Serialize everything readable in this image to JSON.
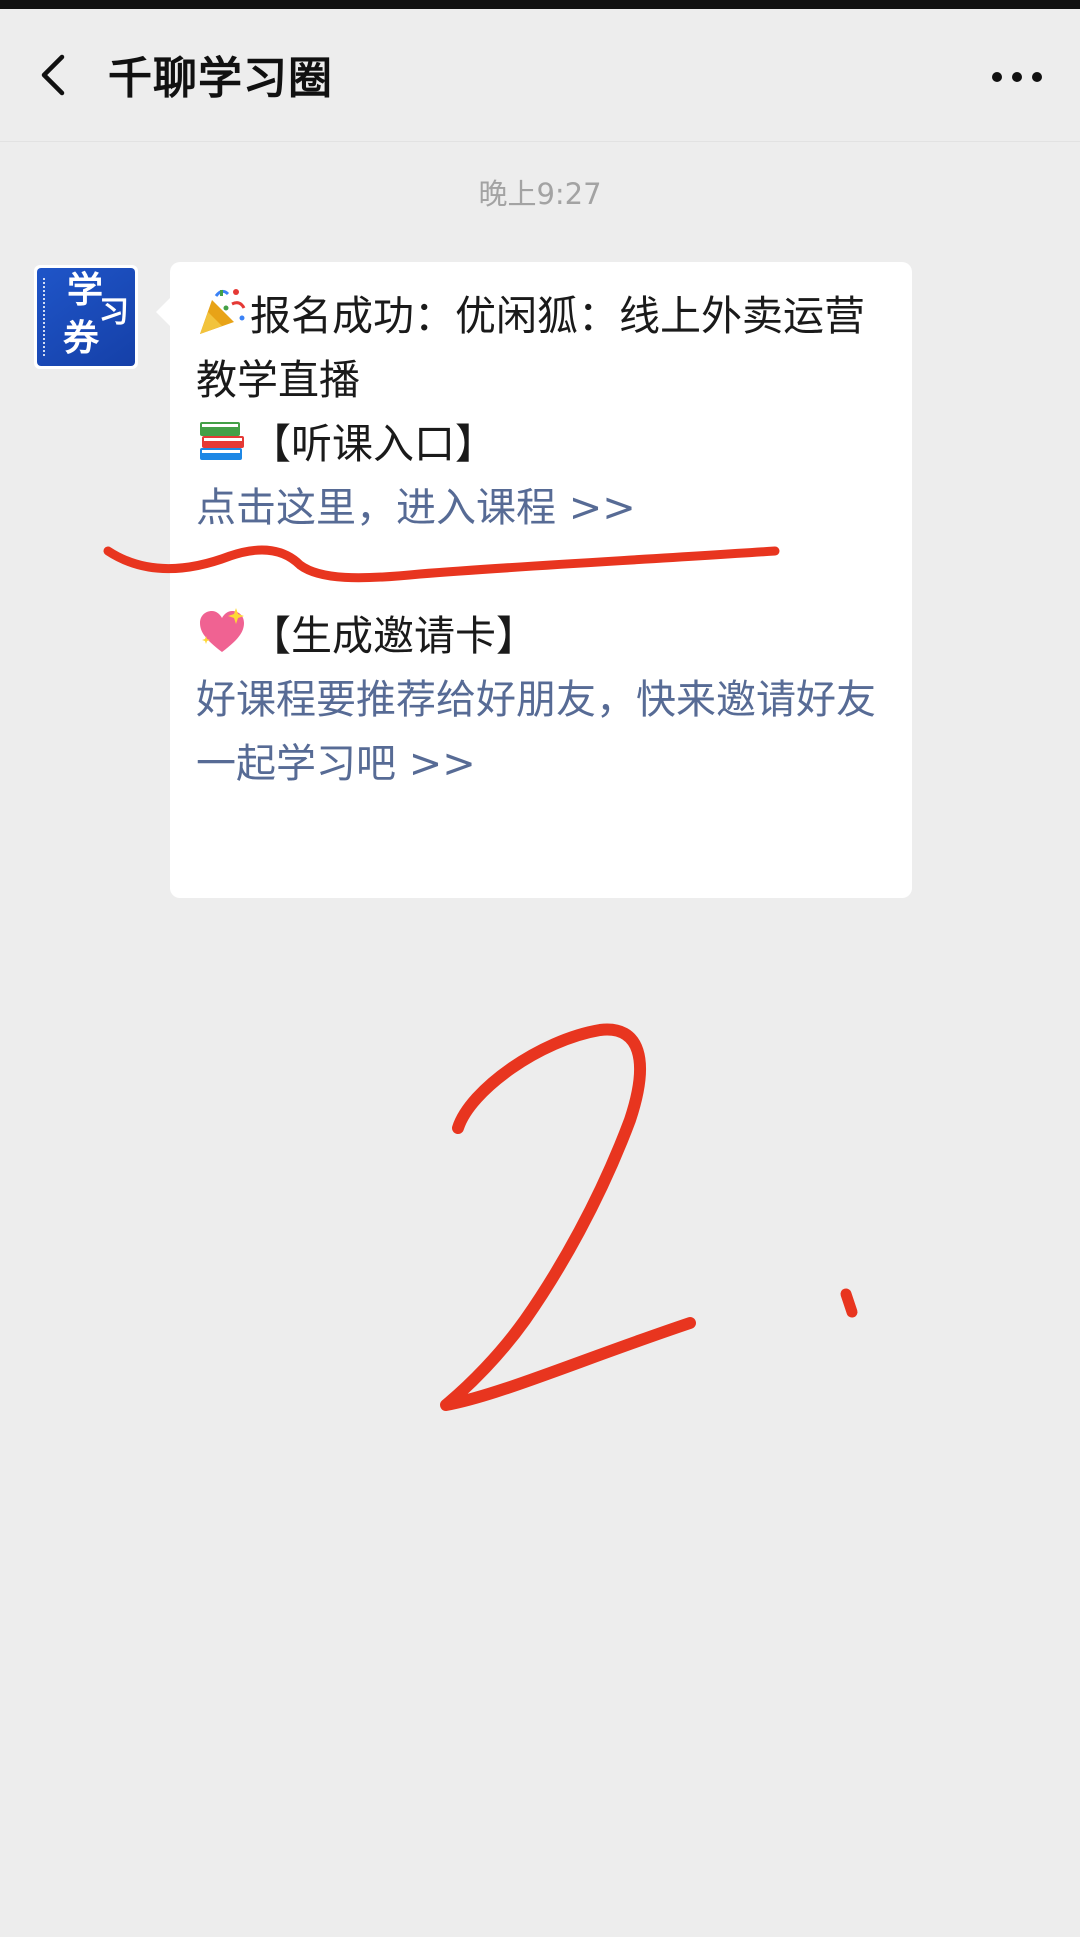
{
  "nav": {
    "title": "千聊学习圈"
  },
  "chat": {
    "timestamp": "晚上9:27",
    "avatar_text": [
      "学",
      "习",
      "券"
    ],
    "message": {
      "headline": "报名成功：优闲狐：线上外卖运营教学直播",
      "listen_label": "【听课入口】",
      "listen_link": "点击这里，进入课程 >>",
      "invite_label": "【生成邀请卡】",
      "invite_link": "好课程要推荐给好朋友，快来邀请好友一起学习吧 >>"
    }
  },
  "icons": {
    "back": "chevron-left-icon",
    "more": "more-dots-icon",
    "party": "party-popper-icon",
    "books": "books-icon",
    "heart": "sparkling-heart-icon"
  },
  "colors": {
    "background": "#ededed",
    "bubble": "#ffffff",
    "link": "#576b95",
    "annotation": "#e8351f",
    "avatar": "#1f55c8"
  },
  "annotation": {
    "number": "2."
  }
}
